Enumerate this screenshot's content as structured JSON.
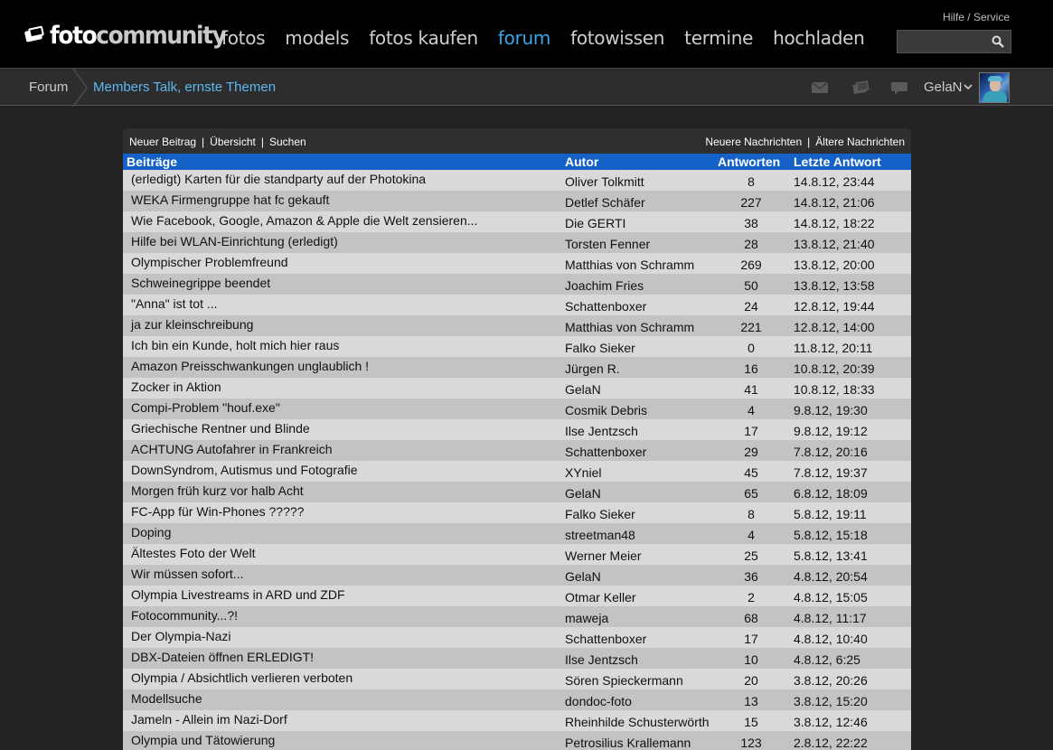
{
  "header": {
    "logo_bold": "foto",
    "logo_light": "community",
    "nav": [
      "fotos",
      "models",
      "fotos kaufen",
      "forum",
      "fotowissen",
      "termine",
      "hochladen"
    ],
    "active_nav": "forum",
    "help_label": "Hilfe / Service",
    "search_placeholder": ""
  },
  "subheader": {
    "crumb_root": "Forum",
    "crumb_current": "Members Talk, ernste Themen",
    "username": "GelaN"
  },
  "toolbar": {
    "new_post": "Neuer Beitrag",
    "overview": "Übersicht",
    "search": "Suchen",
    "newer": "Neuere Nachrichten",
    "older": "Ältere Nachrichten",
    "separator": "|"
  },
  "table": {
    "headers": {
      "title": "Beiträge",
      "author": "Autor",
      "replies": "Antworten",
      "last": "Letzte Antwort"
    },
    "rows": [
      {
        "title": "(erledigt) Karten für die standparty auf der Photokina",
        "author": "Oliver Tolkmitt",
        "replies": "8",
        "last": "14.8.12, 23:44"
      },
      {
        "title": "WEKA Firmengruppe hat fc gekauft",
        "author": "Detlef Schäfer",
        "replies": "227",
        "last": "14.8.12, 21:06"
      },
      {
        "title": "Wie Facebook, Google, Amazon & Apple die Welt zensieren...",
        "author": "Die GERTI",
        "replies": "38",
        "last": "14.8.12, 18:22"
      },
      {
        "title": "Hilfe bei WLAN-Einrichtung (erledigt)",
        "author": "Torsten Fenner",
        "replies": "28",
        "last": "13.8.12, 21:40"
      },
      {
        "title": "Olympischer Problemfreund",
        "author": "Matthias von Schramm",
        "replies": "269",
        "last": "13.8.12, 20:00"
      },
      {
        "title": "Schweinegrippe beendet",
        "author": "Joachim Fries",
        "replies": "50",
        "last": "13.8.12, 13:58"
      },
      {
        "title": "\"Anna\" ist tot ...",
        "author": "Schattenboxer",
        "replies": "24",
        "last": "12.8.12, 19:44"
      },
      {
        "title": "ja zur kleinschreibung",
        "author": "Matthias von Schramm",
        "replies": "221",
        "last": "12.8.12, 14:00"
      },
      {
        "title": "Ich bin ein Kunde, holt mich hier raus",
        "author": "Falko Sieker",
        "replies": "0",
        "last": "11.8.12, 20:11"
      },
      {
        "title": "Amazon Preisschwankungen unglaublich !",
        "author": "Jürgen R.",
        "replies": "16",
        "last": "10.8.12, 20:39"
      },
      {
        "title": "Zocker in Aktion",
        "author": "GelaN",
        "replies": "41",
        "last": "10.8.12, 18:33"
      },
      {
        "title": "Compi-Problem \"houf.exe\"",
        "author": "Cosmik Debris",
        "replies": "4",
        "last": "9.8.12, 19:30"
      },
      {
        "title": "Griechische Rentner und Blinde",
        "author": "Ilse Jentzsch",
        "replies": "17",
        "last": "9.8.12, 19:12"
      },
      {
        "title": "ACHTUNG Autofahrer in Frankreich",
        "author": "Schattenboxer",
        "replies": "29",
        "last": "7.8.12, 20:16"
      },
      {
        "title": "DownSyndrom, Autismus und Fotografie",
        "author": "XYniel",
        "replies": "45",
        "last": "7.8.12, 19:37"
      },
      {
        "title": "Morgen früh kurz vor halb Acht",
        "author": "GelaN",
        "replies": "65",
        "last": "6.8.12, 18:09"
      },
      {
        "title": "FC-App für Win-Phones ?????",
        "author": "Falko Sieker",
        "replies": "8",
        "last": "5.8.12, 19:11"
      },
      {
        "title": "Doping",
        "author": "streetman48",
        "replies": "4",
        "last": "5.8.12, 15:18"
      },
      {
        "title": "Ältestes Foto der Welt",
        "author": "Werner Meier",
        "replies": "25",
        "last": "5.8.12, 13:41"
      },
      {
        "title": "Wir müssen sofort...",
        "author": "GelaN",
        "replies": "36",
        "last": "4.8.12, 20:54"
      },
      {
        "title": "Olympia Livestreams in ARD und ZDF",
        "author": "Otmar Keller",
        "replies": "2",
        "last": "4.8.12, 15:05"
      },
      {
        "title": "Fotocommunity...?!",
        "author": "maweja",
        "replies": "68",
        "last": "4.8.12, 11:17"
      },
      {
        "title": "Der Olympia-Nazi",
        "author": "Schattenboxer",
        "replies": "17",
        "last": "4.8.12, 10:40"
      },
      {
        "title": "DBX-Dateien öffnen ERLEDIGT!",
        "author": "Ilse Jentzsch",
        "replies": "10",
        "last": "4.8.12, 6:25"
      },
      {
        "title": "Olympia / Absichtlich verlieren verboten",
        "author": "Sören Spieckermann",
        "replies": "20",
        "last": "3.8.12, 20:26"
      },
      {
        "title": "Modellsuche",
        "author": "dondoc-foto",
        "replies": "13",
        "last": "3.8.12, 15:20"
      },
      {
        "title": "Jameln - Allein im Nazi-Dorf",
        "author": "Rheinhilde Schusterwörth",
        "replies": "15",
        "last": "3.8.12, 12:46"
      },
      {
        "title": "Olympia und Tätowierung",
        "author": "Petrosilius Krallemann",
        "replies": "123",
        "last": "2.8.12, 22:22"
      }
    ]
  },
  "colors": {
    "nav_active": "#38a7e8",
    "breadcrumb_link": "#5db7f0",
    "table_header": "#1462c7",
    "row_light": "#d9d9d9",
    "row_dark": "#c3c3c3"
  }
}
